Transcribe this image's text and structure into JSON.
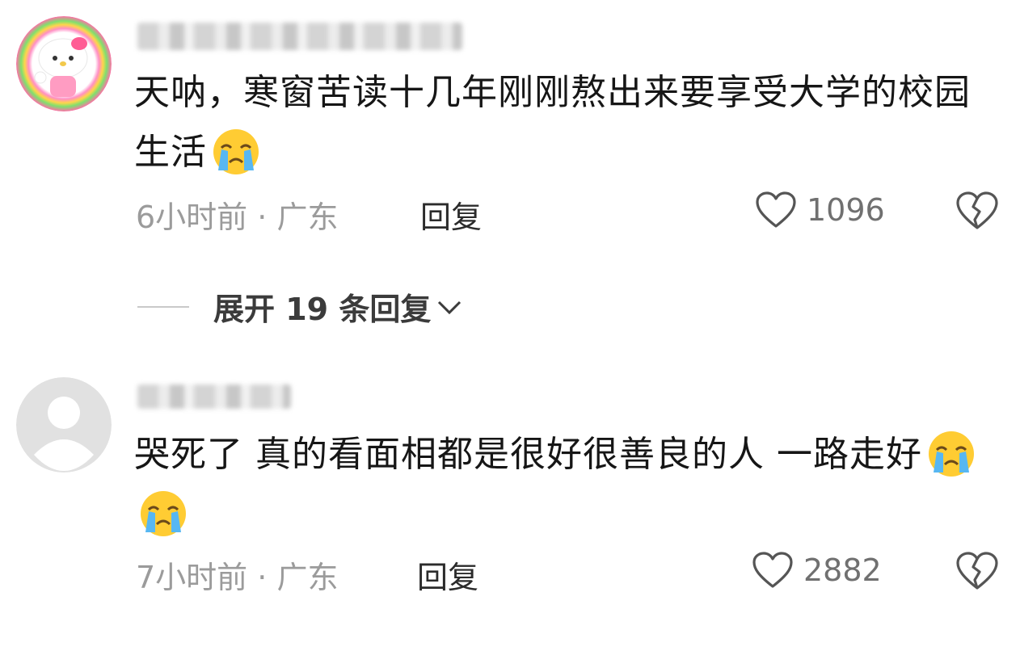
{
  "comments": [
    {
      "text": "天呐，寒窗苦读十几年刚刚熬出来要享受大学的校园生活",
      "emoji": "loudly-crying-face",
      "emoji_count": 1,
      "time": "6小时前",
      "location": "广东",
      "meta_sep": "·",
      "reply_label": "回复",
      "likes": "1096",
      "expand_label": "展开 19 条回复"
    },
    {
      "text": "哭死了 真的看面相都是很好很善良的人 一路走好",
      "emoji": "loudly-crying-face",
      "emoji_count": 2,
      "time": "7小时前",
      "location": "广东",
      "meta_sep": "·",
      "reply_label": "回复",
      "likes": "2882"
    }
  ],
  "icons": {
    "like": "heart-outline-icon",
    "dislike": "broken-heart-icon",
    "expand": "chevron-down-icon"
  },
  "colors": {
    "text": "#161616",
    "meta": "#9b9b9b",
    "icon": "#555555"
  }
}
